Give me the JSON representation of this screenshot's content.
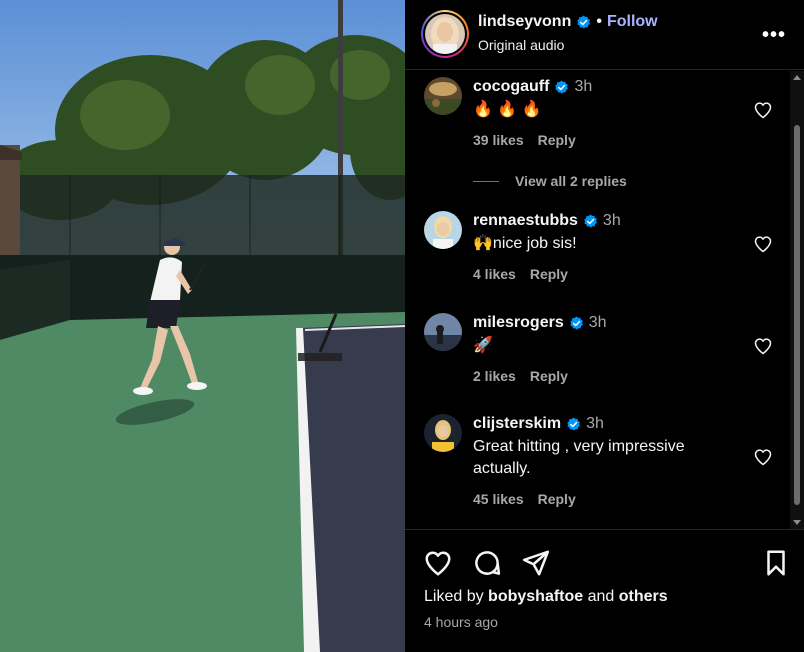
{
  "post": {
    "username": "lindseyvonn",
    "separator": "•",
    "follow_label": "Follow",
    "audio": "Original audio",
    "more_label": "•••"
  },
  "comments": [
    {
      "username": "cocogauff",
      "time": "3h",
      "text": "🔥 🔥 🔥",
      "likes": "39 likes",
      "reply": "Reply"
    },
    {
      "username": "rennaestubbs",
      "time": "3h",
      "text": "🙌nice job sis!",
      "likes": "4 likes",
      "reply": "Reply"
    },
    {
      "username": "milesrogers",
      "time": "3h",
      "text": "🚀",
      "likes": "2 likes",
      "reply": "Reply"
    },
    {
      "username": "clijsterskim",
      "time": "3h",
      "text": "Great hitting , very impressive actually.",
      "likes": "45 likes",
      "reply": "Reply"
    }
  ],
  "view_replies": "View all 2 replies",
  "footer": {
    "liked_by_prefix": "Liked by",
    "liked_by_user": "bobyshaftoe",
    "and": "and",
    "others": "others",
    "time_ago": "4 hours ago"
  },
  "icons": {
    "verified": "verified-badge-icon",
    "heart": "heart-outline-icon",
    "comment": "comment-bubble-icon",
    "share": "paper-plane-icon",
    "save": "bookmark-icon"
  },
  "colors": {
    "verified": "#0095f6",
    "follow": "#a8b4ff",
    "secondary_text": "#a8a8a8",
    "court_green": "#4f8a64",
    "court_blue": "#363b4d"
  }
}
